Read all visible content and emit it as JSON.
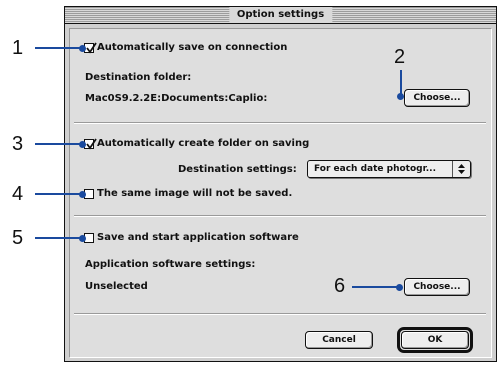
{
  "window": {
    "title": "Option settings"
  },
  "auto_save": {
    "checkbox_label": "Automatically save on connection",
    "checked": true,
    "destination_label": "Destination folder:",
    "destination_path": "Mac0S9.2.2E:Documents:Caplio:",
    "choose_button": "Choose..."
  },
  "auto_folder": {
    "checkbox_label": "Automatically create folder on saving",
    "checked": true,
    "destination_settings_label": "Destination settings:",
    "destination_settings_value": "For each date photogr...",
    "no_duplicate_label": "The same image will not be saved.",
    "no_duplicate_checked": false
  },
  "app_software": {
    "checkbox_label": "Save and start application software",
    "checked": false,
    "settings_label": "Application software settings:",
    "selected_value": "Unselected",
    "choose_button": "Choose..."
  },
  "footer": {
    "cancel_button": "Cancel",
    "ok_button": "OK"
  },
  "callouts": {
    "c1": "1",
    "c2": "2",
    "c3": "3",
    "c4": "4",
    "c5": "5",
    "c6": "6"
  },
  "colors": {
    "leader_line": "#1a4a9e"
  }
}
